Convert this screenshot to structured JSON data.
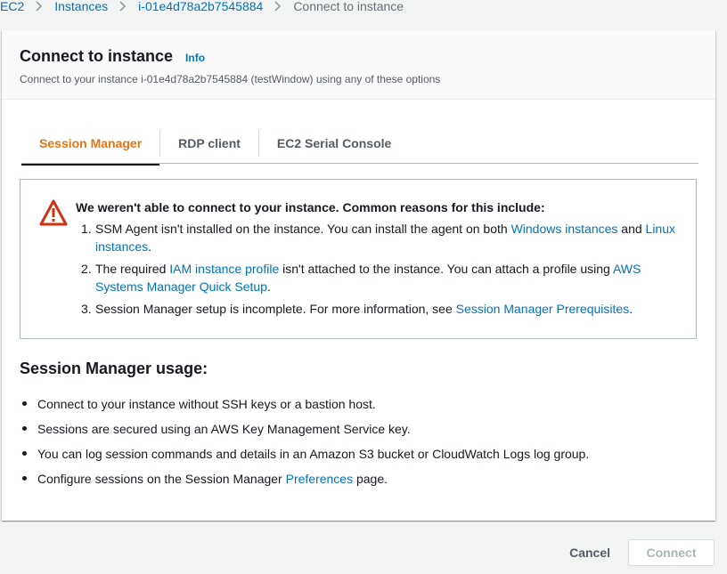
{
  "breadcrumb": {
    "items": [
      "EC2",
      "Instances",
      "i-01e4d78a2b7545884",
      "Connect to instance"
    ]
  },
  "header": {
    "title": "Connect to instance",
    "info": "Info",
    "subtitle": "Connect to your instance i-01e4d78a2b7545884 (testWindow) using any of these options"
  },
  "tabs": [
    {
      "label": "Session Manager",
      "active": true
    },
    {
      "label": "RDP client",
      "active": false
    },
    {
      "label": "EC2 Serial Console",
      "active": false
    }
  ],
  "alert": {
    "icon": "warning-icon",
    "title": "We weren't able to connect to your instance. Common reasons for this include:",
    "items": [
      {
        "num": "1.",
        "t1": "SSM Agent isn't installed on the instance. You can install the agent on both ",
        "l1": "Windows instances",
        "t2": " and ",
        "l2": "Linux instances",
        "t3": "."
      },
      {
        "num": "2.",
        "t1": "The required ",
        "l1": "IAM instance profile",
        "t2": " isn't attached to the instance. You can attach a profile using ",
        "l2": "AWS Systems Manager Quick Setup",
        "t3": "."
      },
      {
        "num": "3.",
        "t1": "Session Manager setup is incomplete. For more information, see ",
        "l1": "Session Manager Prerequisites",
        "t2": "."
      }
    ]
  },
  "usage": {
    "title": "Session Manager usage:",
    "items": [
      {
        "text": "Connect to your instance without SSH keys or a bastion host."
      },
      {
        "text": "Sessions are secured using an AWS Key Management Service key."
      },
      {
        "text": "You can log session commands and details in an Amazon S3 bucket or CloudWatch Logs log group."
      },
      {
        "text": "Configure sessions on the Session Manager ",
        "link": "Preferences",
        "after": " page."
      }
    ]
  },
  "footer": {
    "cancel": "Cancel",
    "connect": "Connect"
  },
  "colors": {
    "accent": "#ec7211",
    "link": "#0073bb",
    "warning": "#d13212"
  }
}
